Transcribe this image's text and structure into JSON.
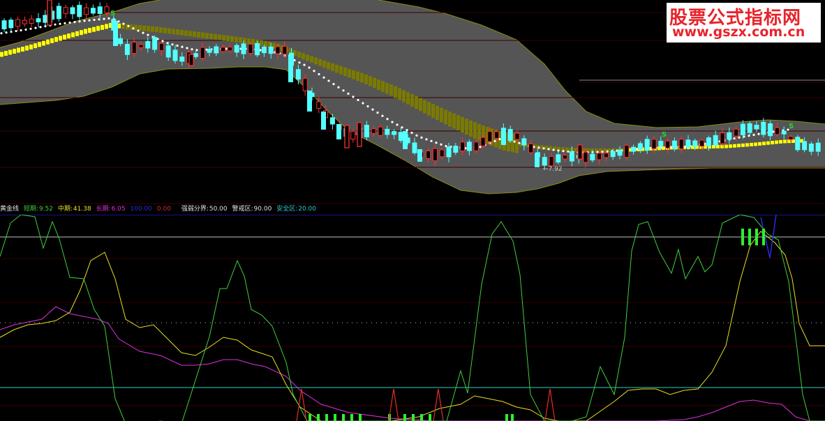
{
  "watermark": {
    "title": "股票公式指标网",
    "url": "www.gszx.com.cn"
  },
  "price_panel": {
    "signal_label": "S",
    "low_marker": "←7.92",
    "colors": {
      "band_fill": "#555555",
      "band_edge": "#8a8a10",
      "up_candle": "#ff3030",
      "down_candle": "#54ffff",
      "dots": "#ffffff",
      "fast_ribbon": "#ffff00",
      "slow_ribbon": "#7a7a00",
      "signal": "#2bd52b"
    }
  },
  "indicator_header": {
    "name": "黄金线",
    "short_label": "短期:",
    "short_value": "9.52",
    "mid_label": "中期:",
    "mid_value": "41.38",
    "long_label": "长期:",
    "long_value": "6.05",
    "max_value": "100.00",
    "min_value": "0.00",
    "strong_weak_label": "强弱分界:",
    "strong_weak_value": "50.00",
    "alert_label": "警戒区:",
    "alert_value": "90.00",
    "safe_label": "安全区:",
    "safe_value": "20.00",
    "colors": {
      "short": "#3fcf3f",
      "mid": "#e8e020",
      "long": "#e030e0",
      "max": "#2222dd",
      "min": "#dd2222",
      "neutral": "#e0e0e0",
      "safe": "#2acccc"
    }
  }
}
